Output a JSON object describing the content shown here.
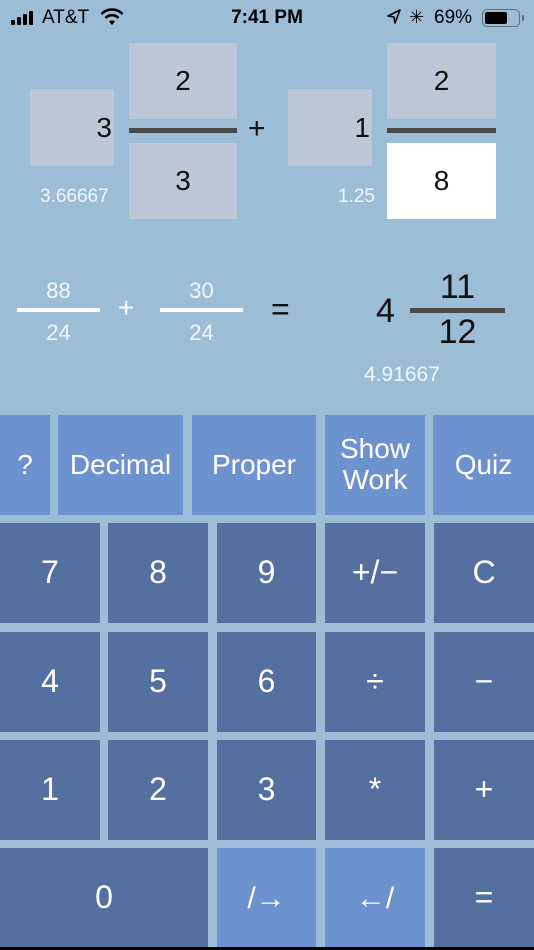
{
  "status_bar": {
    "carrier": "AT&T",
    "time": "7:41 PM",
    "battery_percent_label": "69%",
    "battery_level": 0.69,
    "icons": [
      "signal-bars-icon",
      "wifi-icon",
      "location-arrow-icon",
      "bluetooth-icon",
      "battery-icon"
    ]
  },
  "operand1": {
    "whole": "3",
    "numerator": "2",
    "denominator": "3",
    "decimal": "3.66667"
  },
  "operator": "+",
  "operand2": {
    "whole": "1",
    "numerator": "2",
    "denominator": "8",
    "decimal": "1.25",
    "active_field": "denominator"
  },
  "work": {
    "term1": {
      "numerator": "88",
      "denominator": "24"
    },
    "operator": "+",
    "term2": {
      "numerator": "30",
      "denominator": "24"
    },
    "equals": "="
  },
  "result": {
    "whole": "4",
    "numerator": "11",
    "denominator": "12",
    "decimal": "4.91667"
  },
  "function_keys": {
    "help": "?",
    "decimal": "Decimal",
    "proper": "Proper",
    "show_work": "Show Work",
    "quiz": "Quiz"
  },
  "keypad": {
    "k7": "7",
    "k8": "8",
    "k9": "9",
    "negate": "+/−",
    "clear": "C",
    "k4": "4",
    "k5": "5",
    "k6": "6",
    "divide": "÷",
    "subtract": "−",
    "k1": "1",
    "k2": "2",
    "k3": "3",
    "multiply": "*",
    "add": "+",
    "k0": "0",
    "next_field": "/→",
    "prev_field": "←/",
    "equals": "="
  },
  "colors": {
    "background": "#9bbdd5",
    "function_key": "#6e91d0",
    "number_key": "#5470a0",
    "input_box": "#bcc8d7",
    "active_input": "#ffffff"
  }
}
